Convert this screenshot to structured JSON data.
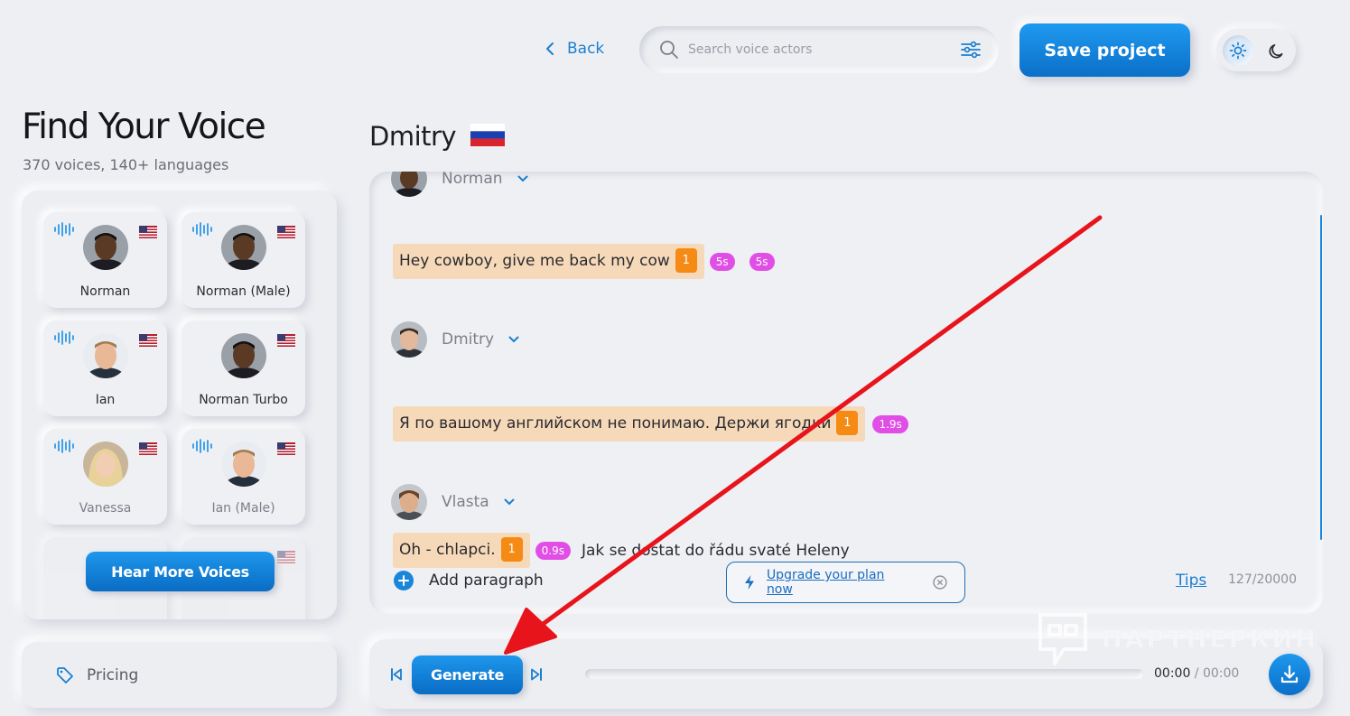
{
  "header": {
    "back_label": "Back",
    "search_placeholder": "Search voice actors",
    "save_label": "Save project",
    "theme": "light"
  },
  "sidebar": {
    "title": "Find Your Voice",
    "subtitle": "370 voices, 140+ languages",
    "voices": [
      {
        "name": "Norman",
        "flag": "us",
        "avatar": "male-dark"
      },
      {
        "name": "Norman (Male)",
        "flag": "us",
        "avatar": "male-dark"
      },
      {
        "name": "Ian",
        "flag": "us",
        "avatar": "male-light"
      },
      {
        "name": "Norman Turbo",
        "flag": "us",
        "avatar": "male-dark"
      },
      {
        "name": "Vanessa",
        "flag": "us",
        "avatar": "female-blonde"
      },
      {
        "name": "Ian (Male)",
        "flag": "us",
        "avatar": "male-light"
      }
    ],
    "hear_more_label": "Hear More Voices",
    "pricing_label": "Pricing"
  },
  "editor": {
    "actor_name": "Dmitry",
    "actor_flag": "ru",
    "blocks": [
      {
        "speaker": "Norman",
        "segments": [
          {
            "text": "Hey cowboy, give me back my cow",
            "highlight": true,
            "badge": "1",
            "time": "5s"
          }
        ],
        "extra_time": "5s"
      },
      {
        "speaker": "Dmitry",
        "segments": [
          {
            "text": "Я по вашому английском не понимаю. Держи ягодки",
            "highlight": true,
            "badge": "1",
            "time": "1.9s"
          }
        ]
      },
      {
        "speaker": "Vlasta",
        "segments": [
          {
            "text": "Oh - chlapci.",
            "highlight": true,
            "badge": "1",
            "time": "0.9s"
          },
          {
            "text": "Jak se dostat do řádu svaté Heleny",
            "highlight": false
          }
        ]
      }
    ],
    "add_paragraph_label": "Add paragraph",
    "upgrade_label": "Upgrade your plan now",
    "tips_label": "Tips",
    "char_count": "127/20000"
  },
  "player": {
    "generate_label": "Generate",
    "current_time": "00:00",
    "separator": " / ",
    "duration": "00:00",
    "progress": 0
  },
  "watermark": "ПАРТНЕРКИН",
  "colors": {
    "accent": "#0b75d1",
    "highlight": "#f6d9b9",
    "badge_orange": "#f58a14",
    "badge_pink": "#e14ee6",
    "annotation_arrow": "#e8141c"
  }
}
